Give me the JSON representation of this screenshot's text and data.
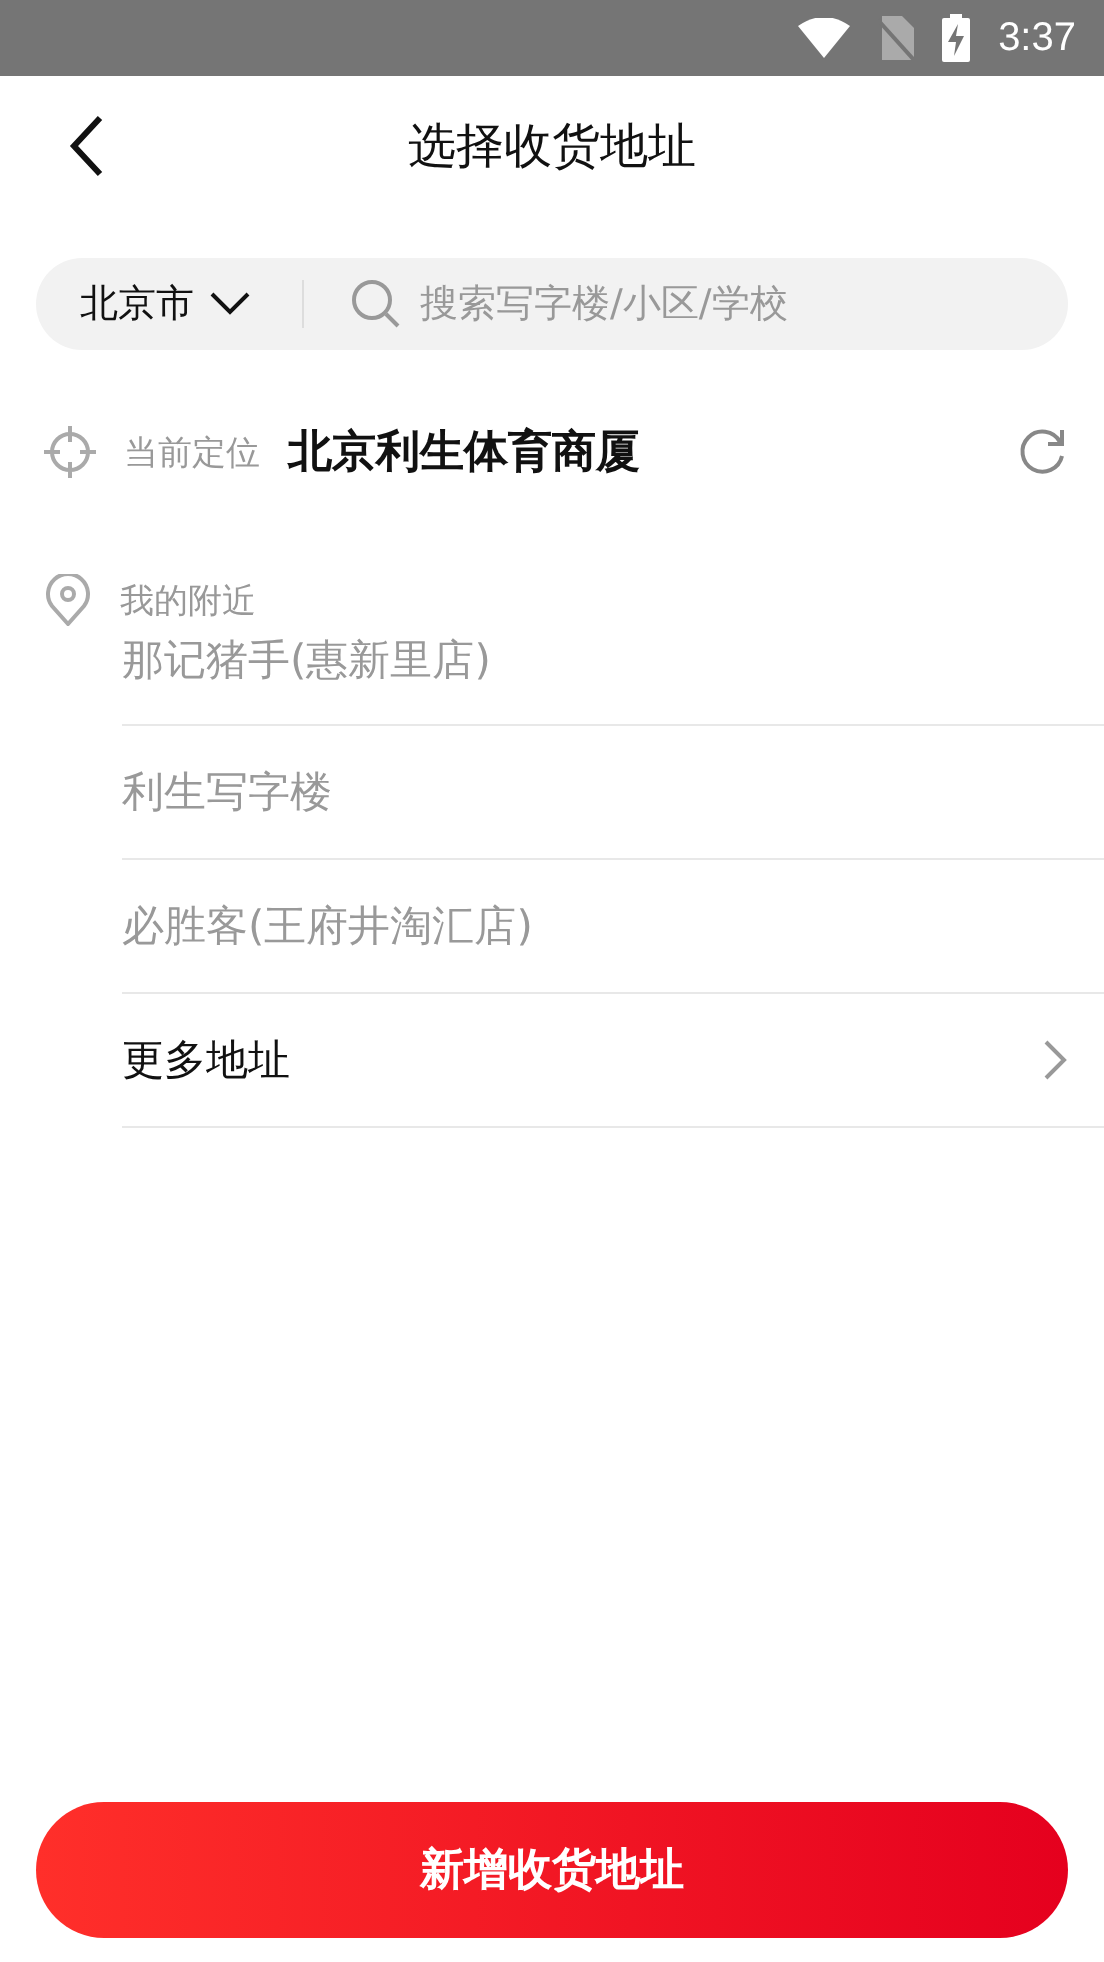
{
  "status_bar": {
    "time": "3:37"
  },
  "header": {
    "title": "选择收货地址"
  },
  "search": {
    "city": "北京市",
    "placeholder": "搜索写字楼/小区/学校"
  },
  "current_location": {
    "label": "当前定位",
    "value": "北京利生体育商厦"
  },
  "nearby": {
    "label": "我的附近",
    "items": [
      {
        "kind": "place",
        "text": "那记猪手(惠新里店)"
      },
      {
        "kind": "place",
        "text": "利生写字楼"
      },
      {
        "kind": "place",
        "text": "必胜客(王府井淘汇店)"
      },
      {
        "kind": "more",
        "text": "更多地址"
      }
    ]
  },
  "add_button": {
    "label": "新增收货地址"
  }
}
